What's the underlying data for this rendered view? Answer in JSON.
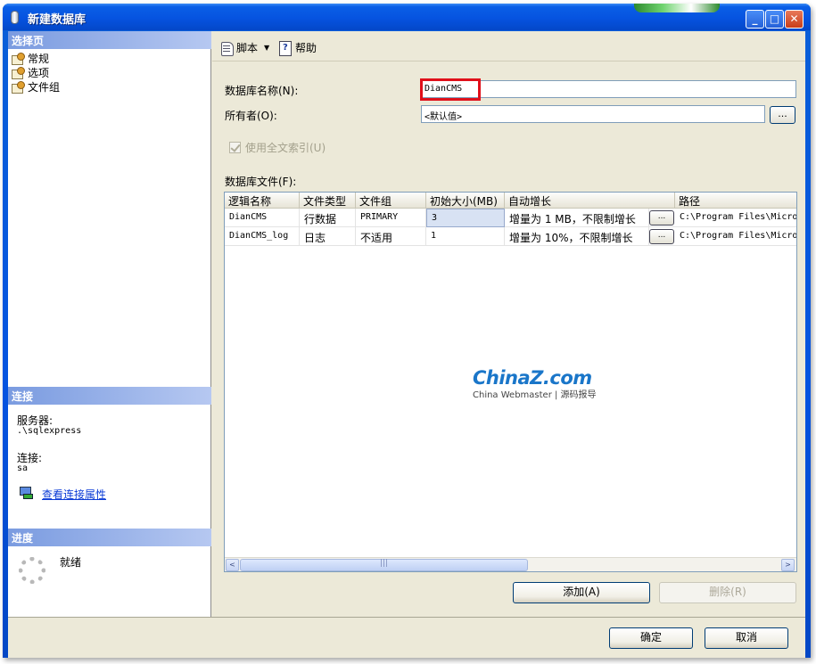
{
  "window": {
    "title": "新建数据库"
  },
  "titlebar_buttons": {
    "minimize": "_",
    "maximize": "□",
    "close": "✕"
  },
  "left": {
    "select_page_header": "选择页",
    "pages": [
      {
        "label": "常规",
        "icon": "page-icon"
      },
      {
        "label": "选项",
        "icon": "page-icon"
      },
      {
        "label": "文件组",
        "icon": "page-icon"
      }
    ],
    "connection_header": "连接",
    "server_label": "服务器:",
    "server_value": ".\\sqlexpress",
    "connection_label": "连接:",
    "connection_value": "sa",
    "view_props_link": "查看连接属性",
    "progress_header": "进度",
    "progress_status": "就绪"
  },
  "toolbar": {
    "script_label": "脚本",
    "help_label": "帮助"
  },
  "form": {
    "db_name_label": "数据库名称(N):",
    "db_name_value": "DianCMS",
    "owner_label": "所有者(O):",
    "owner_value": "<默认值>",
    "owner_browse": "...",
    "fulltext_label": "使用全文索引(U)",
    "fulltext_checked": true,
    "files_label": "数据库文件(F):"
  },
  "grid": {
    "columns": [
      "逻辑名称",
      "文件类型",
      "文件组",
      "初始大小(MB)",
      "自动增长",
      "路径"
    ],
    "rows": [
      {
        "logical_name": "DianCMS",
        "file_type": "行数据",
        "filegroup": "PRIMARY",
        "initial_size": "3",
        "autogrowth": "增量为 1 MB，不限制增长",
        "browse": "...",
        "path": "C:\\Program Files\\Micro"
      },
      {
        "logical_name": "DianCMS_log",
        "file_type": "日志",
        "filegroup": "不适用",
        "initial_size": "1",
        "autogrowth": "增量为 10%，不限制增长",
        "browse": "...",
        "path": "C:\\Program Files\\Micro"
      }
    ],
    "scroll_left": "<",
    "scroll_right": ">"
  },
  "watermark": {
    "logo": "ChinaZ.com",
    "subtitle": "China Webmaster | 源码报导"
  },
  "buttons": {
    "add": "添加(A)",
    "remove": "删除(R)",
    "ok": "确定",
    "cancel": "取消"
  },
  "colors": {
    "titlebar": "#0653e0",
    "section_header": "#7a9be0",
    "highlight": "#e0101a",
    "link": "#0b3bd6"
  }
}
